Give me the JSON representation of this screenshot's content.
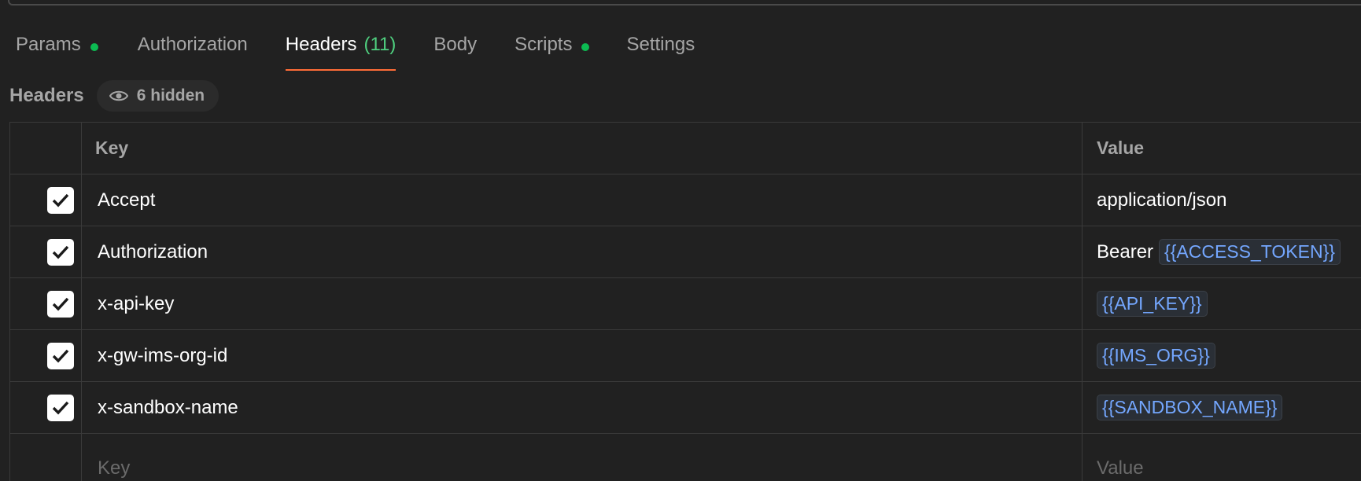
{
  "tabs": [
    {
      "label": "Params",
      "dot": true
    },
    {
      "label": "Authorization"
    },
    {
      "label": "Headers",
      "count": "(11)",
      "active": true
    },
    {
      "label": "Body"
    },
    {
      "label": "Scripts",
      "dot": true
    },
    {
      "label": "Settings"
    }
  ],
  "headers_section": {
    "title": "Headers",
    "hidden_label": "6 hidden"
  },
  "table": {
    "columns": {
      "key": "Key",
      "value": "Value"
    },
    "rows": [
      {
        "key": "Accept",
        "value_text": "application/json",
        "checked": true
      },
      {
        "key": "Authorization",
        "value_text": "Bearer",
        "value_var": "{{ACCESS_TOKEN}}",
        "checked": true
      },
      {
        "key": "x-api-key",
        "value_var": "{{API_KEY}}",
        "checked": true
      },
      {
        "key": "x-gw-ims-org-id",
        "value_var": "{{IMS_ORG}}",
        "checked": true
      },
      {
        "key": "x-sandbox-name",
        "value_var": "{{SANDBOX_NAME}}",
        "checked": true
      }
    ],
    "new_row": {
      "key_placeholder": "Key",
      "value_placeholder": "Value"
    }
  },
  "colors": {
    "accent_tab_underline": "#ff6c37",
    "status_dot": "#0cbb52",
    "variable_text": "#74a7ff"
  }
}
